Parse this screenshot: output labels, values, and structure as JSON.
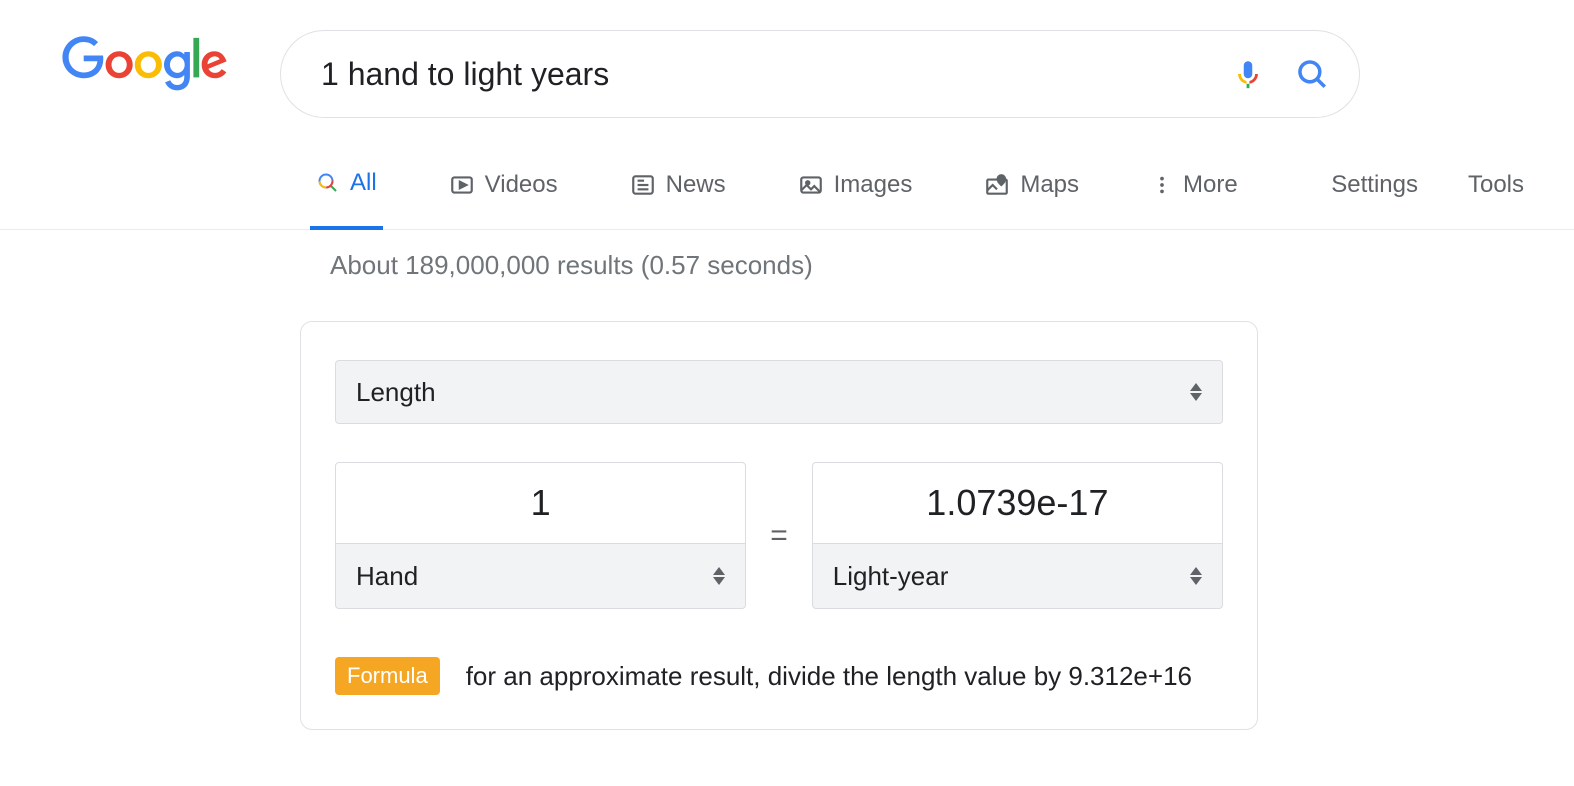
{
  "search": {
    "query": "1 hand to light years"
  },
  "tabs": {
    "all": "All",
    "videos": "Videos",
    "news": "News",
    "images": "Images",
    "maps": "Maps",
    "more": "More"
  },
  "tools": {
    "settings": "Settings",
    "tools": "Tools"
  },
  "result_stats": "About 189,000,000 results (0.57 seconds)",
  "converter": {
    "category": "Length",
    "from_value": "1",
    "from_unit": "Hand",
    "equals": "=",
    "to_value": "1.0739e-17",
    "to_unit": "Light-year",
    "formula_badge": "Formula",
    "formula_text": "for an approximate result, divide the length value by 9.312e+16"
  }
}
